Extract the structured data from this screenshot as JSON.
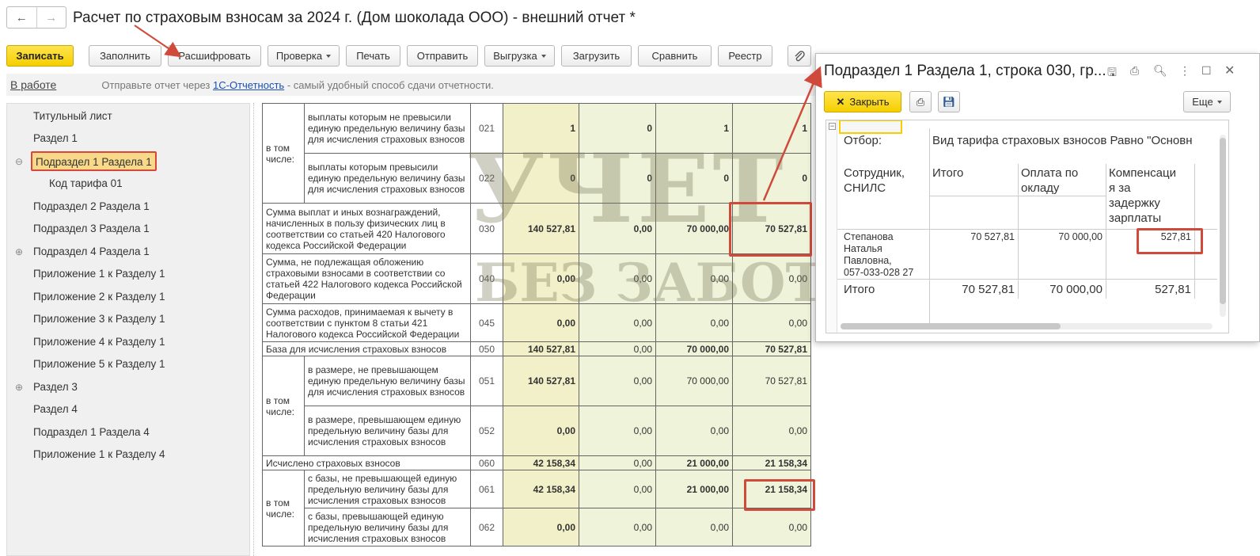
{
  "window": {
    "title": "Расчет по страховым взносам за 2024 г. (Дом шоколада ООО) - внешний отчет *",
    "nav_back": "←",
    "nav_forward": "→"
  },
  "toolbar": {
    "save": "Записать",
    "fill": "Заполнить",
    "decode": "Расшифровать",
    "check": "Проверка",
    "print": "Печать",
    "send": "Отправить",
    "export": "Выгрузка",
    "load": "Загрузить",
    "compare": "Сравнить",
    "registry": "Реестр",
    "attach_icon": "paperclip-icon"
  },
  "status": {
    "state": "В работе",
    "message_before": "Отправьте отчет через ",
    "message_link": "1С-Отчетность",
    "message_after": " - самый удобный способ сдачи отчетности."
  },
  "tree": {
    "items": [
      {
        "label": "Титульный лист",
        "marker": ""
      },
      {
        "label": "Раздел 1",
        "marker": ""
      },
      {
        "label": "Подраздел 1 Раздела 1",
        "marker": "⊖"
      },
      {
        "label": "Код тарифа 01",
        "marker": ""
      },
      {
        "label": "Подраздел 2 Раздела 1",
        "marker": ""
      },
      {
        "label": "Подраздел 3 Раздела 1",
        "marker": ""
      },
      {
        "label": "Подраздел 4 Раздела 1",
        "marker": "⊕"
      },
      {
        "label": "Приложение 1 к Разделу 1",
        "marker": ""
      },
      {
        "label": "Приложение 2 к Разделу 1",
        "marker": ""
      },
      {
        "label": "Приложение 3 к Разделу 1",
        "marker": ""
      },
      {
        "label": "Приложение 4 к Разделу 1",
        "marker": ""
      },
      {
        "label": "Приложение 5 к Разделу 1",
        "marker": ""
      },
      {
        "label": "Раздел 3",
        "marker": "⊕"
      },
      {
        "label": "Раздел 4",
        "marker": ""
      },
      {
        "label": "Подраздел 1 Раздела 4",
        "marker": ""
      },
      {
        "label": "Приложение 1 к Разделу 4",
        "marker": ""
      }
    ]
  },
  "report": {
    "in_that_number": "в том числе:",
    "rows": [
      {
        "desc": "выплаты которым не превысили единую предельную величину базы для исчисления страховых взносов",
        "code": "021",
        "v": [
          "1",
          "0",
          "1",
          "1"
        ],
        "group": "a"
      },
      {
        "desc": "выплаты которым превысили единую предельную величину базы для исчисления страховых взносов",
        "code": "022",
        "v": [
          "0",
          "0",
          "0",
          "0"
        ],
        "group": "a"
      },
      {
        "desc": "Сумма выплат и иных вознаграждений, начисленных в пользу физических лиц в соответствии со статьей 420 Налогового кодекса Российской Федерации",
        "code": "030",
        "v": [
          "140 527,81",
          "0,00",
          "70 000,00",
          "70 527,81"
        ]
      },
      {
        "desc": "Сумма, не подлежащая обложению страховыми взносами в соответствии со статьей 422 Налогового кодекса Российской Федерации",
        "code": "040",
        "v": [
          "0,00",
          "0,00",
          "0,00",
          "0,00"
        ]
      },
      {
        "desc": "Сумма расходов, принимаемая к вычету в соответствии с пунктом 8 статьи 421 Налогового кодекса Российской Федерации",
        "code": "045",
        "v": [
          "0,00",
          "0,00",
          "0,00",
          "0,00"
        ]
      },
      {
        "desc": "База для исчисления страховых взносов",
        "code": "050",
        "v": [
          "140 527,81",
          "0,00",
          "70 000,00",
          "70 527,81"
        ]
      },
      {
        "desc": "в размере, не превышающем единую предельную величину базы для исчисления страховых взносов",
        "code": "051",
        "v": [
          "140 527,81",
          "0,00",
          "70 000,00",
          "70 527,81"
        ],
        "group": "b"
      },
      {
        "desc": "в размере, превышающем единую предельную величину базы для исчисления страховых взносов",
        "code": "052",
        "v": [
          "0,00",
          "0,00",
          "0,00",
          "0,00"
        ],
        "group": "b"
      },
      {
        "desc": "Исчислено страховых взносов",
        "code": "060",
        "v": [
          "42 158,34",
          "0,00",
          "21 000,00",
          "21 158,34"
        ]
      },
      {
        "desc": "с базы, не превышающей единую предельную величину базы для исчисления страховых взносов",
        "code": "061",
        "v": [
          "42 158,34",
          "0,00",
          "21 000,00",
          "21 158,34"
        ],
        "group": "c"
      },
      {
        "desc": "с базы, превышающей единую предельную величину базы для исчисления страховых взносов",
        "code": "062",
        "v": [
          "0,00",
          "0,00",
          "0,00",
          "0,00"
        ],
        "group": "c"
      }
    ]
  },
  "watermark": {
    "line1": "УЧЕТ",
    "line2": "БЕЗ ЗАБОТ"
  },
  "popup": {
    "title": "Подраздел 1 Раздела 1, строка 030, гр...",
    "close_label": "Закрыть",
    "more_label": "Еще",
    "filter_label": "Отбор:",
    "filter_value": "Вид тарифа страховых взносов Равно \"Основн",
    "columns": [
      "Сотрудник, СНИЛС",
      "Итого",
      "Оплата по окладу",
      "Компенсация за задержку зарплаты"
    ],
    "col_header_lines": {
      "c1": [
        "Сотрудник,",
        "СНИЛС"
      ],
      "c2": [
        "Итого"
      ],
      "c3": [
        "Оплата по",
        "окладу"
      ],
      "c4": [
        "Компенсаци",
        "я за",
        "задержку",
        "зарплаты"
      ]
    },
    "row": {
      "employee": [
        "Степанова",
        "Наталья",
        "Павловна,",
        "057-033-028 27"
      ],
      "total": "70 527,81",
      "salary": "70 000,00",
      "compensation": "527,81"
    },
    "totals": {
      "label": "Итого",
      "total": "70 527,81",
      "salary": "70 000,00",
      "compensation": "527,81"
    }
  },
  "colors": {
    "accent_yellow": "#f5cf00",
    "highlight_red": "#d04a3c",
    "selection": "#f8d98a",
    "link": "#1a4fb3"
  }
}
